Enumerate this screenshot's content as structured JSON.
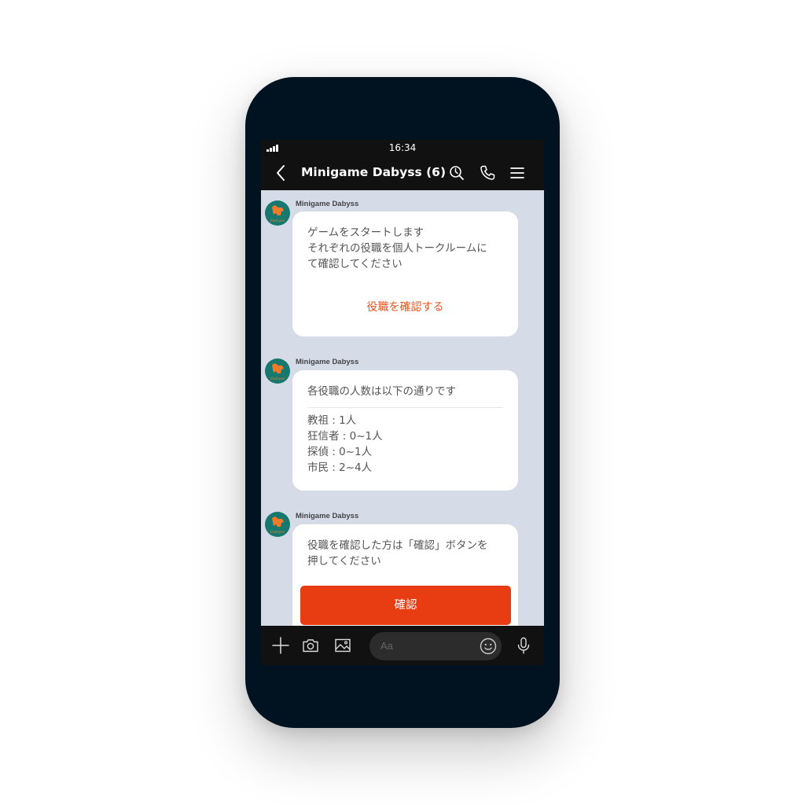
{
  "status_bar": {
    "time": "16:34"
  },
  "header": {
    "title": "Minigame Dabyss (6)"
  },
  "messages": [
    {
      "sender": "Minigame Dabyss",
      "text": "ゲームをスタートします\nそれぞれの役職を個人トークルームに\nて確認してください",
      "action_label": "役職を確認する"
    },
    {
      "sender": "Minigame Dabyss",
      "text": "各役職の人数は以下の通りです",
      "roles": [
        "教祖 : 1人",
        "狂信者 : 0~1人",
        "探偵 : 0~1人",
        "市民 : 2~4人"
      ]
    },
    {
      "sender": "Minigame Dabyss",
      "text": "役職を確認した方は「確認」ボタンを\n押してください",
      "button_label": "確認"
    }
  ],
  "input": {
    "placeholder": "Aa"
  },
  "icons": {
    "avatar": "horse-logo-icon",
    "back": "back-chevron-icon",
    "search": "search-icon",
    "call": "phone-icon",
    "menu": "menu-icon",
    "add": "plus-icon",
    "camera": "camera-icon",
    "gallery": "image-icon",
    "emoji": "emoji-icon",
    "mic": "microphone-icon"
  },
  "colors": {
    "accent": "#e83c12",
    "link": "#e8541f",
    "chat_background": "#d6dbe8",
    "bar_background": "#111111",
    "avatar_background": "#17786f"
  }
}
